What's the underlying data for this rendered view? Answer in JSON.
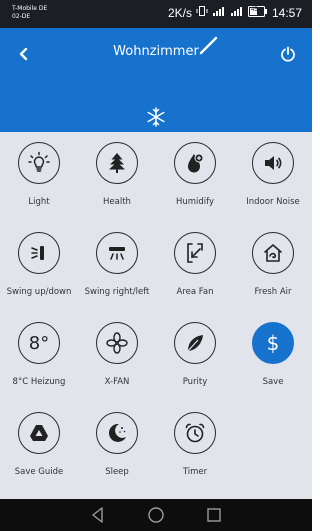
{
  "status": {
    "carrier_line1": "T-Mobile DE",
    "carrier_line2": "02-DE",
    "speed": "2K/s",
    "battery": "45",
    "time": "14:57"
  },
  "header": {
    "title": "Wohnzimmer",
    "back_icon": "chevron-left-icon",
    "power_icon": "power-icon",
    "mode_icon": "snowflake-icon"
  },
  "functions": [
    {
      "label": "Light",
      "icon": "bulb-icon",
      "active": false
    },
    {
      "label": "Health",
      "icon": "tree-icon",
      "active": false
    },
    {
      "label": "Humidify",
      "icon": "drop-icon",
      "active": false
    },
    {
      "label": "Indoor Noise",
      "icon": "speaker-icon",
      "active": false
    },
    {
      "label": "Swing up/down",
      "icon": "swing-vertical-icon",
      "active": false
    },
    {
      "label": "Swing right/left",
      "icon": "swing-horizontal-icon",
      "active": false
    },
    {
      "label": "Area Fan",
      "icon": "area-fan-icon",
      "active": false
    },
    {
      "label": "Fresh Air",
      "icon": "fresh-air-icon",
      "active": false
    },
    {
      "label": "8°C Heizung",
      "icon": "heat-8-icon",
      "active": false,
      "glyph": "8°"
    },
    {
      "label": "X-FAN",
      "icon": "fan-icon",
      "active": false
    },
    {
      "label": "Purity",
      "icon": "leaf-icon",
      "active": false
    },
    {
      "label": "Save",
      "icon": "dollar-icon",
      "active": true,
      "glyph": "$"
    },
    {
      "label": "Save Guide",
      "icon": "save-guide-icon",
      "active": false
    },
    {
      "label": "Sleep",
      "icon": "moon-icon",
      "active": false
    },
    {
      "label": "Timer",
      "icon": "alarm-clock-icon",
      "active": false
    }
  ],
  "accent_color": "#1672cc",
  "nav": {
    "back": "nav-back-icon",
    "home": "nav-home-icon",
    "recents": "nav-recents-icon"
  }
}
